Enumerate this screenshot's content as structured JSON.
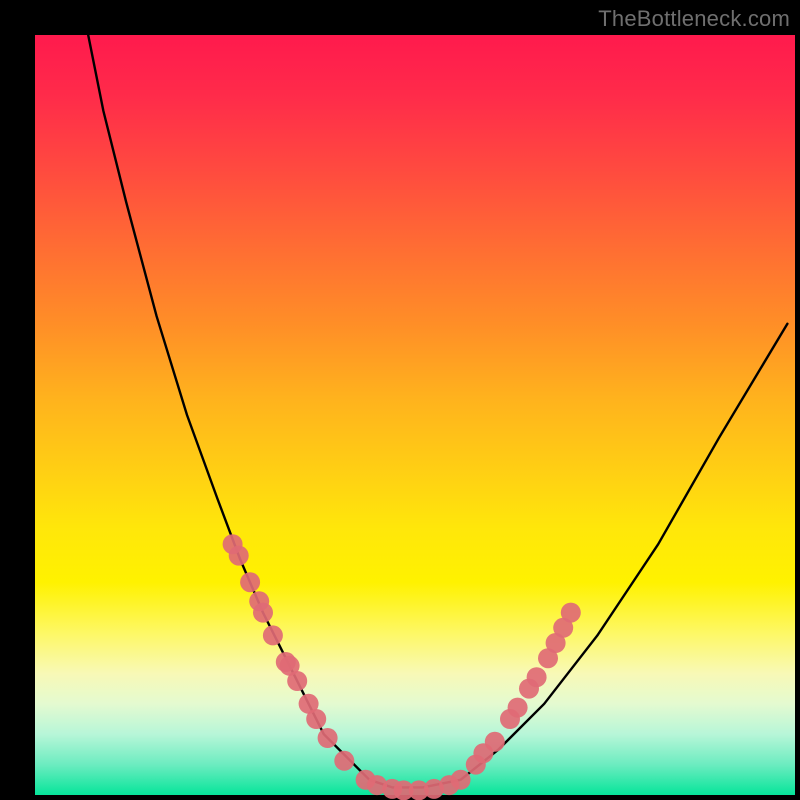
{
  "watermark": "TheBottleneck.com",
  "colors": {
    "frame": "#000000",
    "curve": "#000000",
    "point": "#e06a75",
    "gradient_top": "#ff1a4d",
    "gradient_bottom": "#06e59a"
  },
  "chart_data": {
    "type": "line",
    "title": "",
    "xlabel": "",
    "ylabel": "",
    "xlim": [
      0,
      100
    ],
    "ylim": [
      0,
      100
    ],
    "grid": false,
    "legend": false,
    "note": "Axes are unlabeled; values are normalized percentages of the plot area read from pixel positions. Higher y = higher on screen (curve minimum near bottom center).",
    "series": [
      {
        "name": "curve",
        "kind": "line",
        "x": [
          7,
          9,
          12,
          16,
          20,
          24,
          27,
          30,
          33,
          36,
          38,
          41,
          44,
          47,
          51,
          56,
          61,
          67,
          74,
          82,
          90,
          99
        ],
        "y": [
          100,
          90,
          78,
          63,
          50,
          39,
          31,
          24,
          18,
          12,
          8,
          5,
          2,
          1,
          1,
          2,
          6,
          12,
          21,
          33,
          47,
          62
        ]
      },
      {
        "name": "dots-left",
        "kind": "scatter",
        "x": [
          26.0,
          26.8,
          28.3,
          29.5,
          30.0,
          31.3,
          33.0,
          33.5,
          34.5,
          36.0,
          37.0,
          38.5,
          40.7
        ],
        "y": [
          33.0,
          31.5,
          28.0,
          25.5,
          24.0,
          21.0,
          17.5,
          17.0,
          15.0,
          12.0,
          10.0,
          7.5,
          4.5
        ]
      },
      {
        "name": "dots-bottom",
        "kind": "scatter",
        "x": [
          43.5,
          45.0,
          47.0,
          48.5,
          50.5,
          52.5,
          54.5,
          56.0
        ],
        "y": [
          2.0,
          1.3,
          0.8,
          0.6,
          0.6,
          0.8,
          1.3,
          2.0
        ]
      },
      {
        "name": "dots-right",
        "kind": "scatter",
        "x": [
          58.0,
          59.0,
          60.5,
          62.5,
          63.5,
          65.0,
          66.0,
          67.5,
          68.5,
          69.5,
          70.5
        ],
        "y": [
          4.0,
          5.5,
          7.0,
          10.0,
          11.5,
          14.0,
          15.5,
          18.0,
          20.0,
          22.0,
          24.0
        ]
      }
    ]
  }
}
